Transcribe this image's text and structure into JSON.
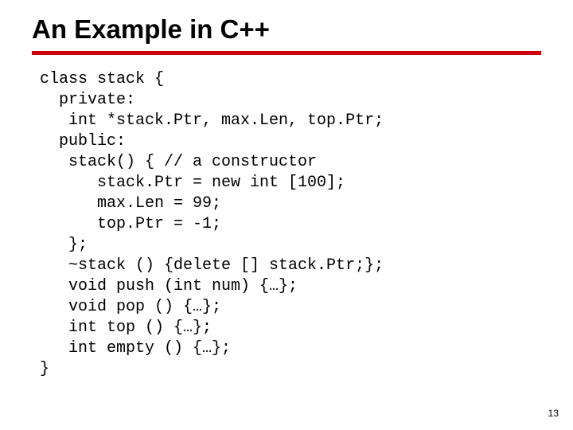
{
  "slide": {
    "title": "An Example in C++",
    "page_number": "13",
    "accent_color": "#cc0000"
  },
  "code": {
    "l01": "class stack {",
    "l02": "  private:",
    "l03": "   int *stack.Ptr, max.Len, top.Ptr;",
    "l04": "  public:",
    "l05": "   stack() { // a constructor",
    "l06": "      stack.Ptr = new int [100];",
    "l07": "      max.Len = 99;",
    "l08": "      top.Ptr = -1;",
    "l09": "   };",
    "l10": "   ~stack () {delete [] stack.Ptr;};",
    "l11": "   void push (int num) {…};",
    "l12": "   void pop () {…};",
    "l13": "   int top () {…};",
    "l14": "   int empty () {…};",
    "l15": "}"
  }
}
